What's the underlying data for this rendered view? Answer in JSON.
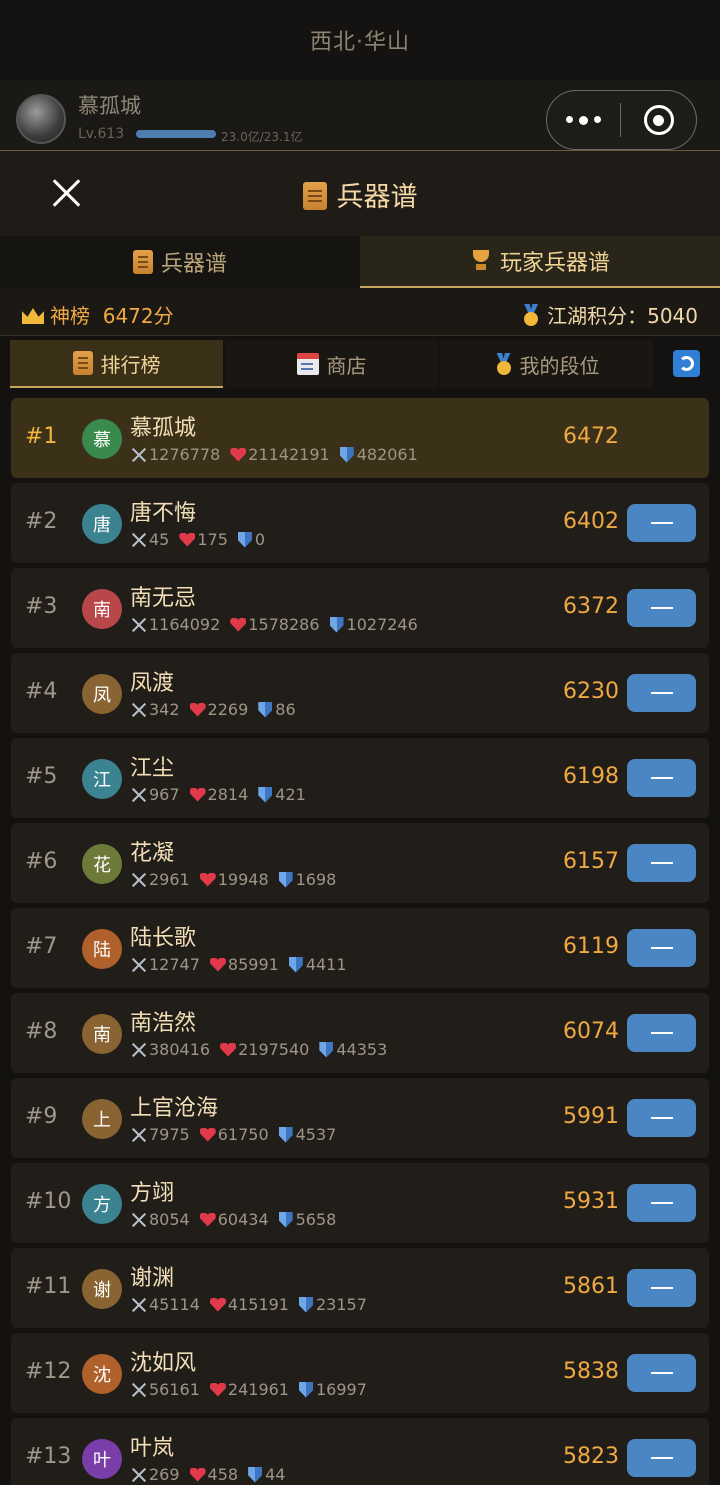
{
  "header": {
    "title": "西北·华山"
  },
  "user": {
    "name": "慕孤城",
    "level": "Lv.613",
    "xp_text": "23.0亿/23.1亿",
    "xp_fraction": 0.996
  },
  "modal": {
    "title": "兵器谱",
    "close_icon": "close-icon"
  },
  "tabs": [
    {
      "label": "兵器谱",
      "icon": "scroll-icon"
    },
    {
      "label": "玩家兵器谱",
      "icon": "trophy-icon",
      "active": true
    }
  ],
  "score_bar": {
    "left_label": "神榜",
    "left_value": "6472分",
    "right_label": "江湖积分：",
    "right_value": "5040"
  },
  "subtabs": [
    {
      "label": "排行榜",
      "icon": "scroll-icon",
      "active": true
    },
    {
      "label": "商店",
      "icon": "calendar-icon"
    },
    {
      "label": "我的段位",
      "icon": "medal-icon"
    }
  ],
  "colors": {
    "accent": "#f0a942",
    "button": "#4a86c4",
    "top_row": "#3b3018"
  },
  "rankings": [
    {
      "rank": "#1",
      "char": "慕",
      "name": "慕孤城",
      "attack": "1276778",
      "hp": "21142191",
      "defense": "482061",
      "score": "6472",
      "color": "#3a8a4e"
    },
    {
      "rank": "#2",
      "char": "唐",
      "name": "唐不悔",
      "attack": "45",
      "hp": "175",
      "defense": "0",
      "score": "6402",
      "color": "#3b8390"
    },
    {
      "rank": "#3",
      "char": "南",
      "name": "南无忌",
      "attack": "1164092",
      "hp": "1578286",
      "defense": "1027246",
      "score": "6372",
      "color": "#b9474a"
    },
    {
      "rank": "#4",
      "char": "凤",
      "name": "凤渡",
      "attack": "342",
      "hp": "2269",
      "defense": "86",
      "score": "6230",
      "color": "#8a6332"
    },
    {
      "rank": "#5",
      "char": "江",
      "name": "江尘",
      "attack": "967",
      "hp": "2814",
      "defense": "421",
      "score": "6198",
      "color": "#3b8390"
    },
    {
      "rank": "#6",
      "char": "花",
      "name": "花凝",
      "attack": "2961",
      "hp": "19948",
      "defense": "1698",
      "score": "6157",
      "color": "#6e7a3a"
    },
    {
      "rank": "#7",
      "char": "陆",
      "name": "陆长歌",
      "attack": "12747",
      "hp": "85991",
      "defense": "4411",
      "score": "6119",
      "color": "#b0602a"
    },
    {
      "rank": "#8",
      "char": "南",
      "name": "南浩然",
      "attack": "380416",
      "hp": "2197540",
      "defense": "44353",
      "score": "6074",
      "color": "#8a6332"
    },
    {
      "rank": "#9",
      "char": "上",
      "name": "上官沧海",
      "attack": "7975",
      "hp": "61750",
      "defense": "4537",
      "score": "5991",
      "color": "#8a6332"
    },
    {
      "rank": "#10",
      "char": "方",
      "name": "方翊",
      "attack": "8054",
      "hp": "60434",
      "defense": "5658",
      "score": "5931",
      "color": "#3b8390"
    },
    {
      "rank": "#11",
      "char": "谢",
      "name": "谢渊",
      "attack": "45114",
      "hp": "415191",
      "defense": "23157",
      "score": "5861",
      "color": "#8a6332"
    },
    {
      "rank": "#12",
      "char": "沈",
      "name": "沈如风",
      "attack": "56161",
      "hp": "241961",
      "defense": "16997",
      "score": "5838",
      "color": "#b0602a"
    },
    {
      "rank": "#13",
      "char": "叶",
      "name": "叶岚",
      "attack": "269",
      "hp": "458",
      "defense": "44",
      "score": "5823",
      "color": "#7a3ea8"
    }
  ]
}
